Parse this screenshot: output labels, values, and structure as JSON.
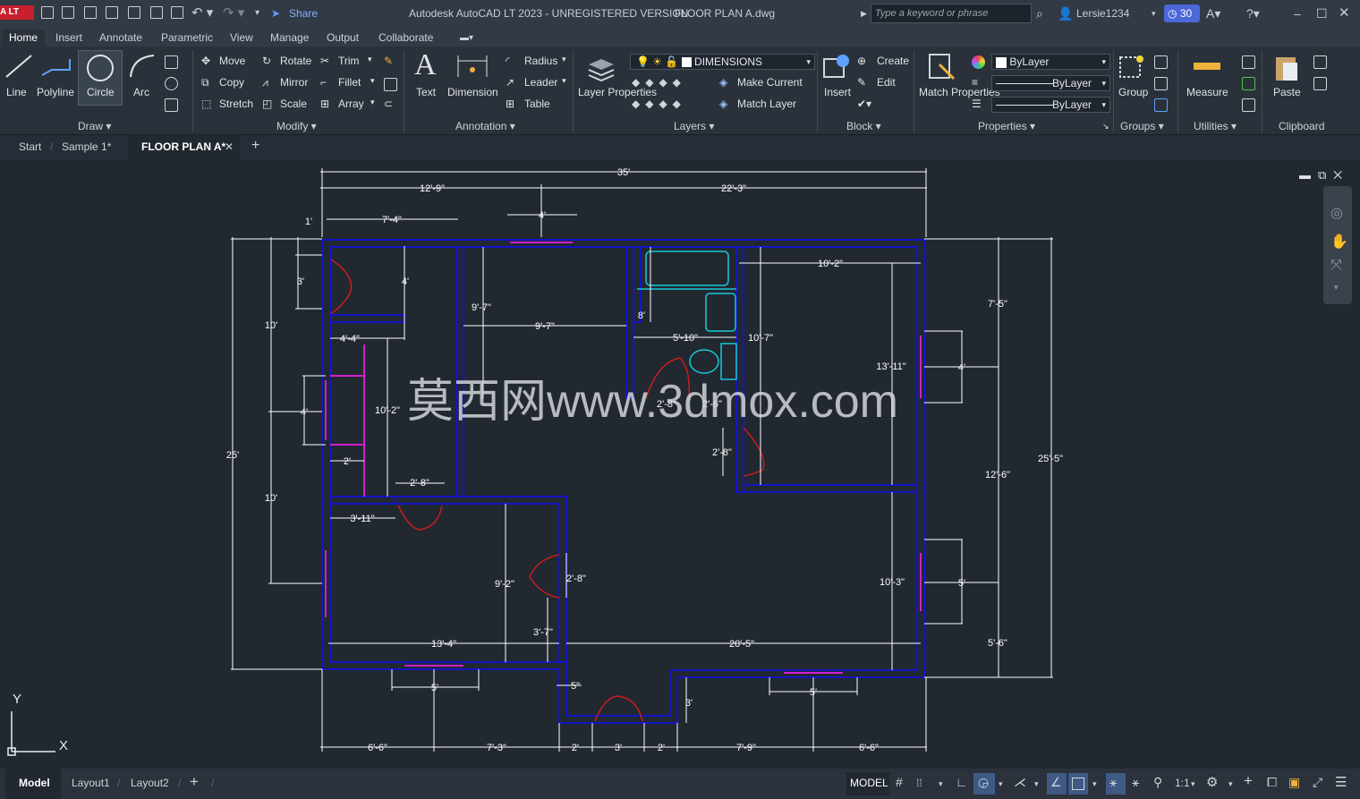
{
  "titlebar": {
    "app_badge": "A LT",
    "share_label": "Share",
    "title": "Autodesk AutoCAD LT 2023 - UNREGISTERED VERSION",
    "filename": "FLOOR PLAN A.dwg",
    "search_placeholder": "Type a keyword or phrase",
    "user": "Lersie1234",
    "trial_days": "30"
  },
  "ribbon_tabs": [
    "Home",
    "Insert",
    "Annotate",
    "Parametric",
    "View",
    "Manage",
    "Output",
    "Collaborate"
  ],
  "draw": {
    "title": "Draw",
    "line": "Line",
    "polyline": "Polyline",
    "circle": "Circle",
    "arc": "Arc"
  },
  "modify": {
    "title": "Modify",
    "move": "Move",
    "rotate": "Rotate",
    "trim": "Trim",
    "copy": "Copy",
    "mirror": "Mirror",
    "fillet": "Fillet",
    "stretch": "Stretch",
    "scale": "Scale",
    "array": "Array"
  },
  "annotation": {
    "title": "Annotation",
    "text": "Text",
    "dimension": "Dimension",
    "radius": "Radius",
    "leader": "Leader",
    "table": "Table"
  },
  "layers": {
    "title": "Layers",
    "layer_properties": "Layer Properties",
    "current_layer": "DIMENSIONS",
    "make_current": "Make Current",
    "match_layer": "Match Layer"
  },
  "block": {
    "title": "Block",
    "insert": "Insert",
    "create": "Create",
    "edit": "Edit"
  },
  "properties": {
    "title": "Properties",
    "match_properties": "Match Properties",
    "color": "ByLayer",
    "linetype": "ByLayer",
    "lineweight": "ByLayer"
  },
  "groups": {
    "title": "Groups",
    "group": "Group"
  },
  "utilities": {
    "title": "Utilities",
    "measure": "Measure"
  },
  "clipboard": {
    "title": "Clipboard",
    "paste": "Paste"
  },
  "doc_tabs": {
    "start": "Start",
    "sample": "Sample 1*",
    "active": "FLOOR PLAN A*"
  },
  "drawing": {
    "watermark": "莫西网www.3dmox.com",
    "ucs_x": "X",
    "ucs_y": "Y",
    "dims": {
      "d35": "35'",
      "d12_9": "12'-9\"",
      "d22_3": "22'-3\"",
      "d1": "1'",
      "d7_4": "7'-4\"",
      "d4top": "4'",
      "d10_2h": "10'-2\"",
      "d3": "3'",
      "d4b": "4'",
      "d10a": "10'",
      "d9_7v": "9'-7\"",
      "d8": "8'",
      "d9_7h": "9'-7\"",
      "d4_4": "4'-4\"",
      "d5_10": "5'-10\"",
      "d10_7": "10'-7\"",
      "d7_5": "7'-5\"",
      "d13_11": "13'-11\"",
      "d4r": "4'",
      "d4l": "4'",
      "d10_2v": "10'-2\"",
      "d25": "25'",
      "d2_8a": "2'-8\"",
      "d2_6": "2'-6\"",
      "d2_8b": "2'-8\"",
      "d25_5": "25'-5\"",
      "d12_6": "12'-6\"",
      "d2": "2'",
      "d2_8c": "2'-8\"",
      "d10b": "10'",
      "d3_11": "3'-11\"",
      "d9_2": "9'-2\"",
      "d2_8d": "2'-8\"",
      "d10_3": "10'-3\"",
      "d5r": "5'",
      "d3_7": "3'-7\"",
      "d13_4": "13'-4\"",
      "d20_5": "20'-5\"",
      "d5_6": "5'-6\"",
      "d5a": "5'",
      "d5b": "5\"",
      "d3b": "3'",
      "d5c": "5'",
      "d6_6a": "6'-6\"",
      "d7_3": "7'-3\"",
      "d2a": "2'",
      "d3c": "3'",
      "d2b": "2'",
      "d7_9": "7'-9\"",
      "d6_6b": "6'-6\""
    }
  },
  "status": {
    "model_tab": "Model",
    "layout1": "Layout1",
    "layout2": "Layout2",
    "model_space": "MODEL",
    "scale": "1:1"
  },
  "colors": {
    "wall": "#1414c8",
    "dim": "#ffffff",
    "door": "#c81e1e",
    "window": "#d020d0",
    "fixture": "#18c8d8",
    "accent": "#4a68d8"
  }
}
